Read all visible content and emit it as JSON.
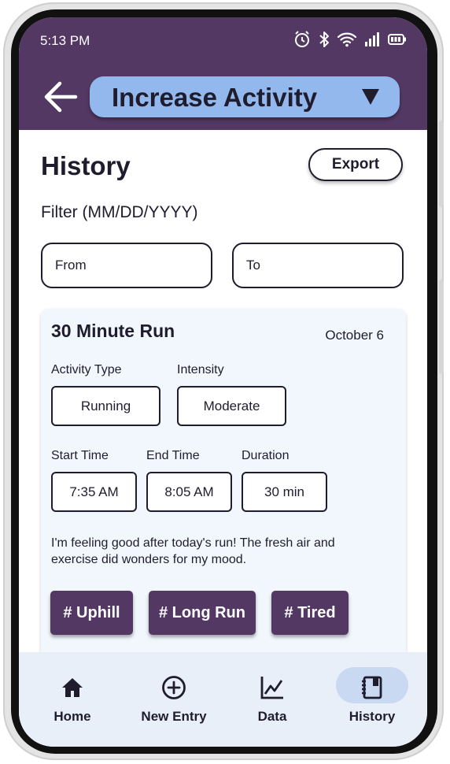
{
  "status_bar": {
    "time": "5:13 PM",
    "icons": [
      "alarm-icon",
      "bluetooth-icon",
      "wifi-icon",
      "signal-icon",
      "battery-icon"
    ]
  },
  "header": {
    "back_icon": "arrow-left-icon",
    "goal_selected": "Increase Activity",
    "caret_icon": "triangle-down-icon"
  },
  "history": {
    "title": "History",
    "export_label": "Export",
    "filter_label": "Filter (MM/DD/YYYY)",
    "from_placeholder": "From",
    "to_placeholder": "To"
  },
  "entry": {
    "title": "30 Minute Run",
    "date": "October 6",
    "activity_type_label": "Activity Type",
    "activity_type": "Running",
    "intensity_label": "Intensity",
    "intensity": "Moderate",
    "start_time_label": "Start Time",
    "start_time": "7:35 AM",
    "end_time_label": "End Time",
    "end_time": "8:05 AM",
    "duration_label": "Duration",
    "duration": "30 min",
    "note": "I'm feeling good after today's run! The fresh air and exercise did wonders for my mood.",
    "tags": [
      "# Uphill",
      "# Long Run",
      "# Tired"
    ]
  },
  "nav": {
    "items": [
      {
        "label": "Home",
        "icon": "home-icon"
      },
      {
        "label": "New Entry",
        "icon": "plus-circle-icon"
      },
      {
        "label": "Data",
        "icon": "line-chart-icon"
      },
      {
        "label": "History",
        "icon": "journal-icon",
        "active": true
      }
    ]
  },
  "colors": {
    "header": "#533864",
    "goal_select": "#93b8ee",
    "card_bg": "#f2f7fd",
    "tag_bg": "#533864",
    "nav_bg": "#e8eff9",
    "nav_active_pill": "#c9d9f2",
    "text": "#1f1c2e"
  }
}
